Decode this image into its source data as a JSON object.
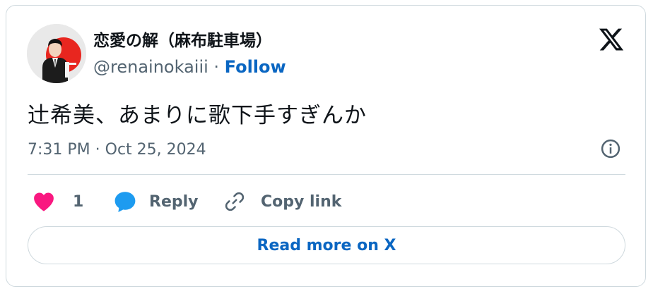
{
  "author": {
    "display_name": "恋愛の解（麻布駐車場）",
    "handle": "@renainokaiii",
    "separator": " · ",
    "follow_label": "Follow",
    "avatar_icon": "avatar-man-suit-red-sun"
  },
  "tweet": {
    "text": "辻希美、あまりに歌下手すぎんか",
    "timestamp": "7:31 PM · Oct 25, 2024"
  },
  "actions": {
    "like_count": "1",
    "reply_label": "Reply",
    "copy_link_label": "Copy link"
  },
  "read_more_label": "Read more on X",
  "icons": {
    "platform": "x-logo-icon",
    "info": "info-icon",
    "like": "heart-icon",
    "reply": "reply-bubble-icon",
    "copy": "link-icon"
  },
  "colors": {
    "heart": "#f91880",
    "reply_bubble": "#1d9bf0",
    "link_blue": "#0a66c2",
    "text": "#0f1419",
    "secondary_text": "#536471",
    "border": "#cfd9de"
  }
}
